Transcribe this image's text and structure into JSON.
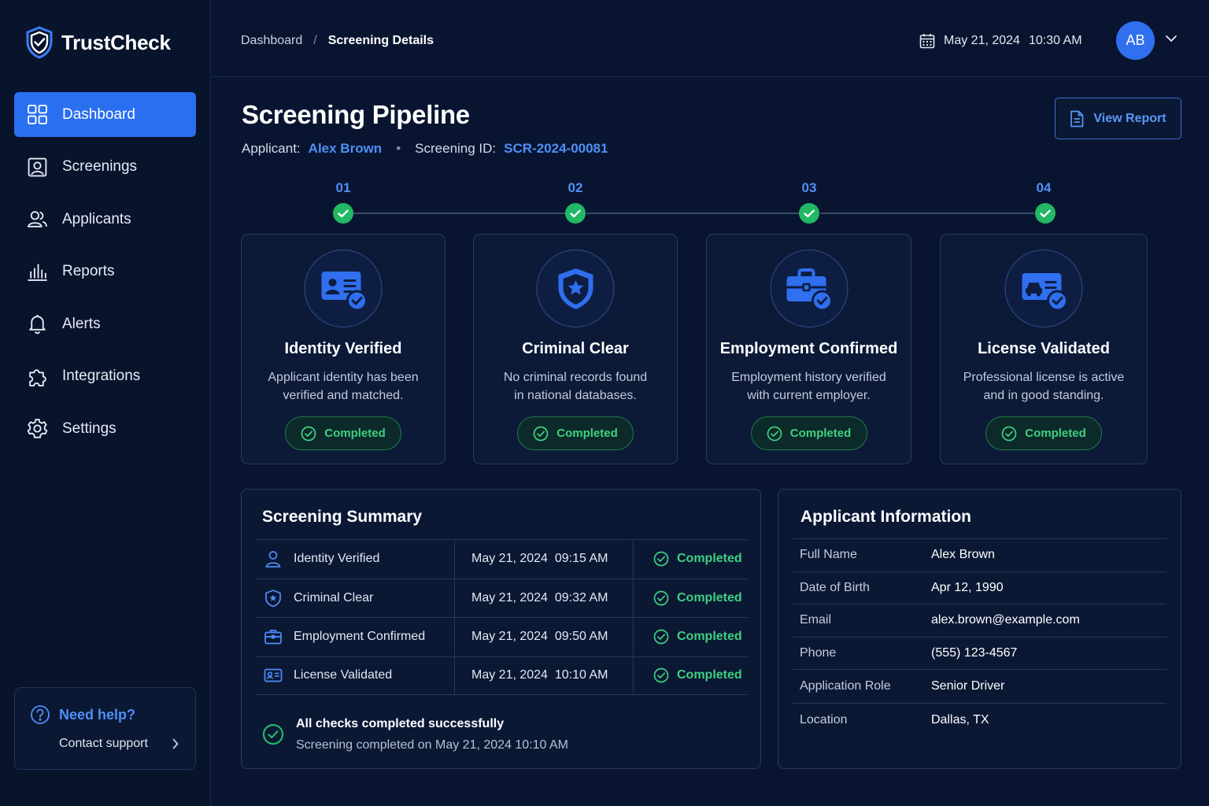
{
  "brand": {
    "name": "TrustCheck"
  },
  "nav": [
    {
      "label": "Dashboard",
      "icon": "dashboard-grid-icon",
      "active": true
    },
    {
      "label": "Screenings",
      "icon": "screening-portrait-icon"
    },
    {
      "label": "Applicants",
      "icon": "users-icon"
    },
    {
      "label": "Reports",
      "icon": "bar-chart-icon"
    },
    {
      "label": "Alerts",
      "icon": "bell-icon"
    },
    {
      "label": "Integrations",
      "icon": "puzzle-icon"
    },
    {
      "label": "Settings",
      "icon": "gear-icon"
    }
  ],
  "help": {
    "title": "Need help?",
    "link": "Contact support"
  },
  "breadcrumb": {
    "root": "Dashboard",
    "separator": "/",
    "current": "Screening Details"
  },
  "header": {
    "date": "May 21, 2024",
    "time": "10:30 AM",
    "avatar_initials": "AB"
  },
  "page": {
    "title": "Screening Pipeline",
    "applicant_label": "Applicant:",
    "applicant_name": "Alex Brown",
    "bullet": "•",
    "screening_id_label": "Screening ID:",
    "screening_id": "SCR-2024-00081",
    "view_report": "View Report"
  },
  "steps": [
    {
      "num": "01",
      "title": "Identity Verified",
      "desc1": "Applicant identity has been",
      "desc2": "verified and matched.",
      "status": "Completed",
      "icon": "id-card-icon"
    },
    {
      "num": "02",
      "title": "Criminal Clear",
      "desc1": "No criminal records found",
      "desc2": "in national databases.",
      "status": "Completed",
      "icon": "shield-star-icon"
    },
    {
      "num": "03",
      "title": "Employment Confirmed",
      "desc1": "Employment history verified",
      "desc2": "with current employer.",
      "status": "Completed",
      "icon": "briefcase-icon"
    },
    {
      "num": "04",
      "title": "License Validated",
      "desc1": "Professional license is active",
      "desc2": "and in good standing.",
      "status": "Completed",
      "icon": "license-card-icon"
    }
  ],
  "summary": {
    "title": "Screening Summary",
    "rows": [
      {
        "check": "Identity Verified",
        "date": "May 21, 2024",
        "time": "09:15 AM",
        "status": "Completed"
      },
      {
        "check": "Criminal Clear",
        "date": "May 21, 2024",
        "time": "09:32 AM",
        "status": "Completed"
      },
      {
        "check": "Employment Confirmed",
        "date": "May 21, 2024",
        "time": "09:50 AM",
        "status": "Completed"
      },
      {
        "check": "License Validated",
        "date": "May 21, 2024",
        "time": "10:10 AM",
        "status": "Completed"
      }
    ],
    "footer_title": "All checks completed successfully",
    "footer_sub": "Screening completed on May 21, 2024 10:10 AM"
  },
  "applicant_info": {
    "title": "Applicant Information",
    "rows": [
      {
        "label": "Full Name",
        "value": "Alex Brown"
      },
      {
        "label": "Date of Birth",
        "value": "Apr 12, 1990"
      },
      {
        "label": "Email",
        "value": "alex.brown@example.com"
      },
      {
        "label": "Phone",
        "value": "(555) 123-4567"
      },
      {
        "label": "Application Role",
        "value": "Senior Driver"
      },
      {
        "label": "Location",
        "value": "Dallas, TX"
      }
    ]
  },
  "colors": {
    "accent": "#2a6ff0",
    "success": "#22b865",
    "background": "#091530"
  }
}
